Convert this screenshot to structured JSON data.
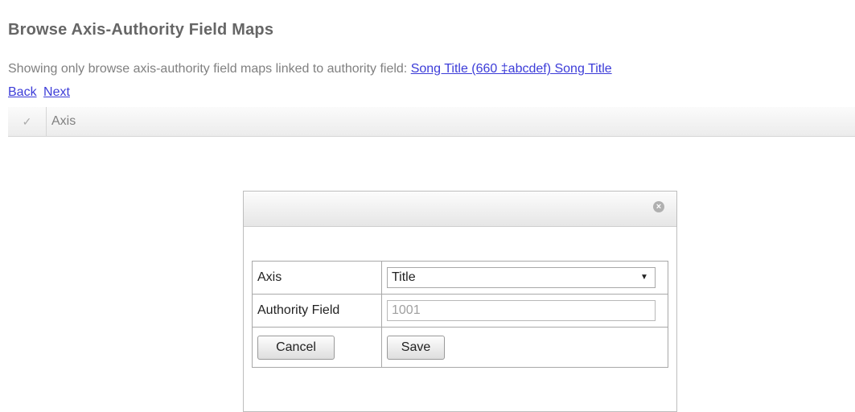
{
  "page": {
    "title": "Browse Axis-Authority Field Maps",
    "filter_text": "Showing only browse axis-authority field maps linked to authority field: ",
    "filter_link": "Song Title (660 ‡abcdef) Song Title",
    "nav": {
      "back": "Back",
      "next": "Next"
    }
  },
  "grid": {
    "check_header": "✓",
    "axis_header": "Axis"
  },
  "dialog": {
    "close_glyph": "×",
    "rows": {
      "axis_label": "Axis",
      "axis_value": "Title",
      "authority_field_label": "Authority Field",
      "authority_field_value": "1001"
    },
    "buttons": {
      "cancel": "Cancel",
      "save": "Save"
    }
  },
  "colors": {
    "link": "#3c3cd8",
    "title_text": "#666666"
  }
}
